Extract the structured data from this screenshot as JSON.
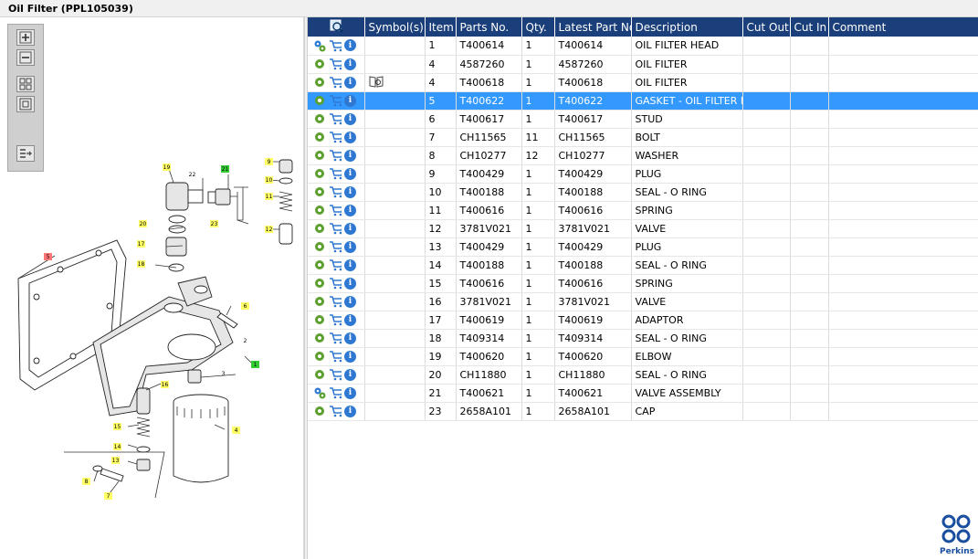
{
  "window": {
    "title": "Oil Filter (PPL105039)"
  },
  "toolbar": {
    "buttons": [
      {
        "name": "zoom-in-button",
        "icon": "zoom-in-icon"
      },
      {
        "name": "zoom-out-button",
        "icon": "zoom-out-icon"
      },
      {
        "name": "fit-button",
        "icon": "fit-icon"
      },
      {
        "name": "actual-size-button",
        "icon": "frame-icon"
      },
      {
        "name": "list-button",
        "icon": "list-arrow-icon"
      }
    ]
  },
  "diagram": {
    "callouts": [
      "9",
      "10",
      "11",
      "12",
      "19",
      "22",
      "21",
      "23",
      "20",
      "17",
      "18",
      "5",
      "6",
      "2",
      "3",
      "1",
      "16",
      "4",
      "15",
      "14",
      "13",
      "8",
      "7"
    ]
  },
  "table": {
    "columns": [
      "",
      "Symbol(s)",
      "Item",
      "Parts No.",
      "Qty.",
      "Latest Part No.",
      "Description",
      "Cut Out",
      "Cut In",
      "Comment"
    ],
    "selected_index": 3,
    "rows": [
      {
        "item": "1",
        "part_no": "T400614",
        "qty": "1",
        "latest": "T400614",
        "desc": "OIL FILTER HEAD",
        "assembly": true,
        "symbol": ""
      },
      {
        "item": "4",
        "part_no": "4587260",
        "qty": "1",
        "latest": "4587260",
        "desc": "OIL FILTER",
        "assembly": false,
        "symbol": ""
      },
      {
        "item": "4",
        "part_no": "T400618",
        "qty": "1",
        "latest": "T400618",
        "desc": "OIL FILTER",
        "assembly": false,
        "symbol": "book-icon"
      },
      {
        "item": "5",
        "part_no": "T400622",
        "qty": "1",
        "latest": "T400622",
        "desc": "GASKET - OIL FILTER HEAD",
        "assembly": false,
        "symbol": ""
      },
      {
        "item": "6",
        "part_no": "T400617",
        "qty": "1",
        "latest": "T400617",
        "desc": "STUD",
        "assembly": false,
        "symbol": ""
      },
      {
        "item": "7",
        "part_no": "CH11565",
        "qty": "11",
        "latest": "CH11565",
        "desc": "BOLT",
        "assembly": false,
        "symbol": ""
      },
      {
        "item": "8",
        "part_no": "CH10277",
        "qty": "12",
        "latest": "CH10277",
        "desc": "WASHER",
        "assembly": false,
        "symbol": ""
      },
      {
        "item": "9",
        "part_no": "T400429",
        "qty": "1",
        "latest": "T400429",
        "desc": "PLUG",
        "assembly": false,
        "symbol": ""
      },
      {
        "item": "10",
        "part_no": "T400188",
        "qty": "1",
        "latest": "T400188",
        "desc": "SEAL - O RING",
        "assembly": false,
        "symbol": ""
      },
      {
        "item": "11",
        "part_no": "T400616",
        "qty": "1",
        "latest": "T400616",
        "desc": "SPRING",
        "assembly": false,
        "symbol": ""
      },
      {
        "item": "12",
        "part_no": "3781V021",
        "qty": "1",
        "latest": "3781V021",
        "desc": "VALVE",
        "assembly": false,
        "symbol": ""
      },
      {
        "item": "13",
        "part_no": "T400429",
        "qty": "1",
        "latest": "T400429",
        "desc": "PLUG",
        "assembly": false,
        "symbol": ""
      },
      {
        "item": "14",
        "part_no": "T400188",
        "qty": "1",
        "latest": "T400188",
        "desc": "SEAL - O RING",
        "assembly": false,
        "symbol": ""
      },
      {
        "item": "15",
        "part_no": "T400616",
        "qty": "1",
        "latest": "T400616",
        "desc": "SPRING",
        "assembly": false,
        "symbol": ""
      },
      {
        "item": "16",
        "part_no": "3781V021",
        "qty": "1",
        "latest": "3781V021",
        "desc": "VALVE",
        "assembly": false,
        "symbol": ""
      },
      {
        "item": "17",
        "part_no": "T400619",
        "qty": "1",
        "latest": "T400619",
        "desc": "ADAPTOR",
        "assembly": false,
        "symbol": ""
      },
      {
        "item": "18",
        "part_no": "T409314",
        "qty": "1",
        "latest": "T409314",
        "desc": "SEAL - O RING",
        "assembly": false,
        "symbol": ""
      },
      {
        "item": "19",
        "part_no": "T400620",
        "qty": "1",
        "latest": "T400620",
        "desc": "ELBOW",
        "assembly": false,
        "symbol": ""
      },
      {
        "item": "20",
        "part_no": "CH11880",
        "qty": "1",
        "latest": "CH11880",
        "desc": "SEAL - O RING",
        "assembly": false,
        "symbol": ""
      },
      {
        "item": "21",
        "part_no": "T400621",
        "qty": "1",
        "latest": "T400621",
        "desc": "VALVE ASSEMBLY",
        "assembly": true,
        "symbol": ""
      },
      {
        "item": "23",
        "part_no": "2658A101",
        "qty": "1",
        "latest": "2658A101",
        "desc": "CAP",
        "assembly": false,
        "symbol": ""
      }
    ]
  },
  "brand": {
    "name": "Perkins",
    "color": "#1a4fa0"
  },
  "colors": {
    "header": "#1a3f7a",
    "selected": "#3399ff",
    "gear": "#5aa02c",
    "cart": "#2f78d1"
  }
}
